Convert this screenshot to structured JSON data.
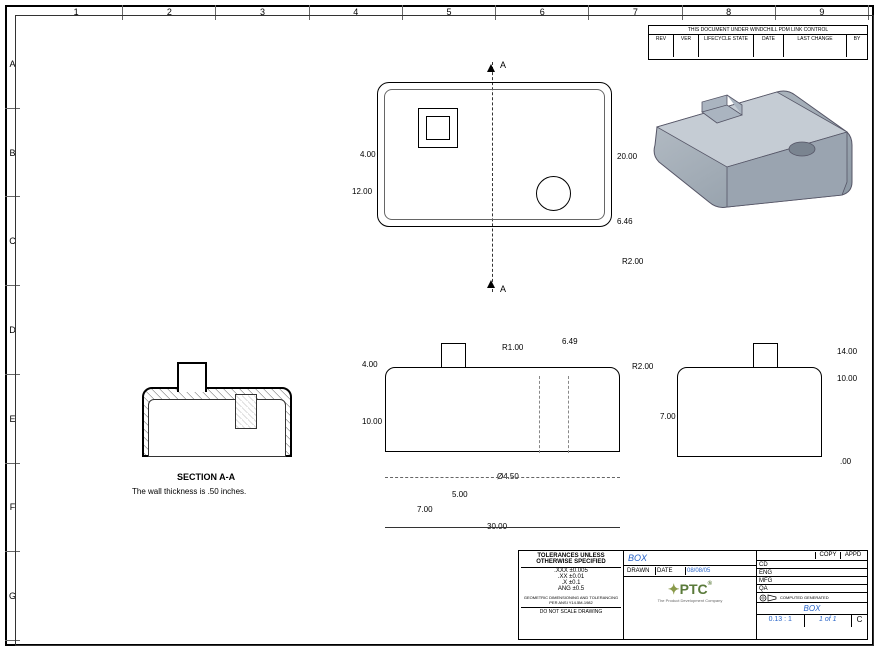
{
  "grid": {
    "cols": [
      "1",
      "2",
      "3",
      "4",
      "5",
      "6",
      "7",
      "8",
      "9"
    ],
    "rows": [
      "A",
      "B",
      "C",
      "D",
      "E",
      "F",
      "G"
    ]
  },
  "revision_block": {
    "header": "THIS DOCUMENT UNDER WINDCHILL PDM LINK CONTROL",
    "cols": [
      "REV",
      "VER",
      "LIFECYCLE STATE",
      "DATE",
      "LAST CHANGE",
      "BY"
    ]
  },
  "dimensions": {
    "top_width": "20.00",
    "top_height": "12.00",
    "boss_sq": "4.00",
    "fillet_r2": "R2.00",
    "fillet_r1": "R1.00",
    "hole_offset": "6.46",
    "front_height": "10.00",
    "boss_height": "4.00",
    "hole_x": "6.49",
    "hole_dia": "Ø4.50",
    "pos_5": "5.00",
    "pos_7": "7.00",
    "overall_30": "30.00",
    "side_14": "14.00",
    "side_10": "10.00",
    "side_7": "7.00",
    "side_0": ".00"
  },
  "section": {
    "label": "SECTION A-A",
    "note": "The wall thickness is .50 inches.",
    "cut_a1": "A",
    "cut_a2": "A"
  },
  "title_block": {
    "tolerances_header": "TOLERANCES UNLESS OTHERWISE SPECIFIED",
    "tol_lines": [
      ".XXX ±0.005",
      ".XX ±0.01",
      ".X ±0.1",
      "ANG ±0.5"
    ],
    "gdt": "GEOMETRIC DIMENSIONING AND TOLERANCING PER ANSI Y14.5M-1982",
    "no_scale": "DO NOT SCALE DRAWING",
    "title": "BOX",
    "drawn": "DRAWN",
    "date": "DATE",
    "date_val": "08/08/05",
    "scale": "0.13 : 1",
    "sheet": "1 of 1",
    "ptc": "PTC",
    "ptc_tag": "The Product Development Company",
    "sheet_label": "C",
    "computer_gen": "COMPUTED GENERATED",
    "copy": "COPY",
    "appd": "APPD",
    "cd": "CD",
    "eng": "ENG",
    "mfg": "MFG",
    "qa": "QA"
  },
  "chart_data": {
    "type": "table",
    "title": "BOX Engineering Drawing",
    "views": [
      "Top",
      "Section A-A",
      "Front",
      "Right Side",
      "Isometric"
    ],
    "key_dimensions": {
      "length": 30.0,
      "width": 20.0,
      "depth": 14.0,
      "height": 10.0,
      "boss_height": 4.0,
      "boss_square": 4.0,
      "hole_diameter": 4.5,
      "hole_offset_x": 6.49,
      "hole_offset_y": 6.46,
      "wall_thickness": 0.5,
      "outer_fillet": 2.0,
      "boss_fillet": 1.0,
      "ref_12": 12.0,
      "ref_7a": 7.0,
      "ref_7b": 7.0,
      "ref_5": 5.0
    }
  }
}
